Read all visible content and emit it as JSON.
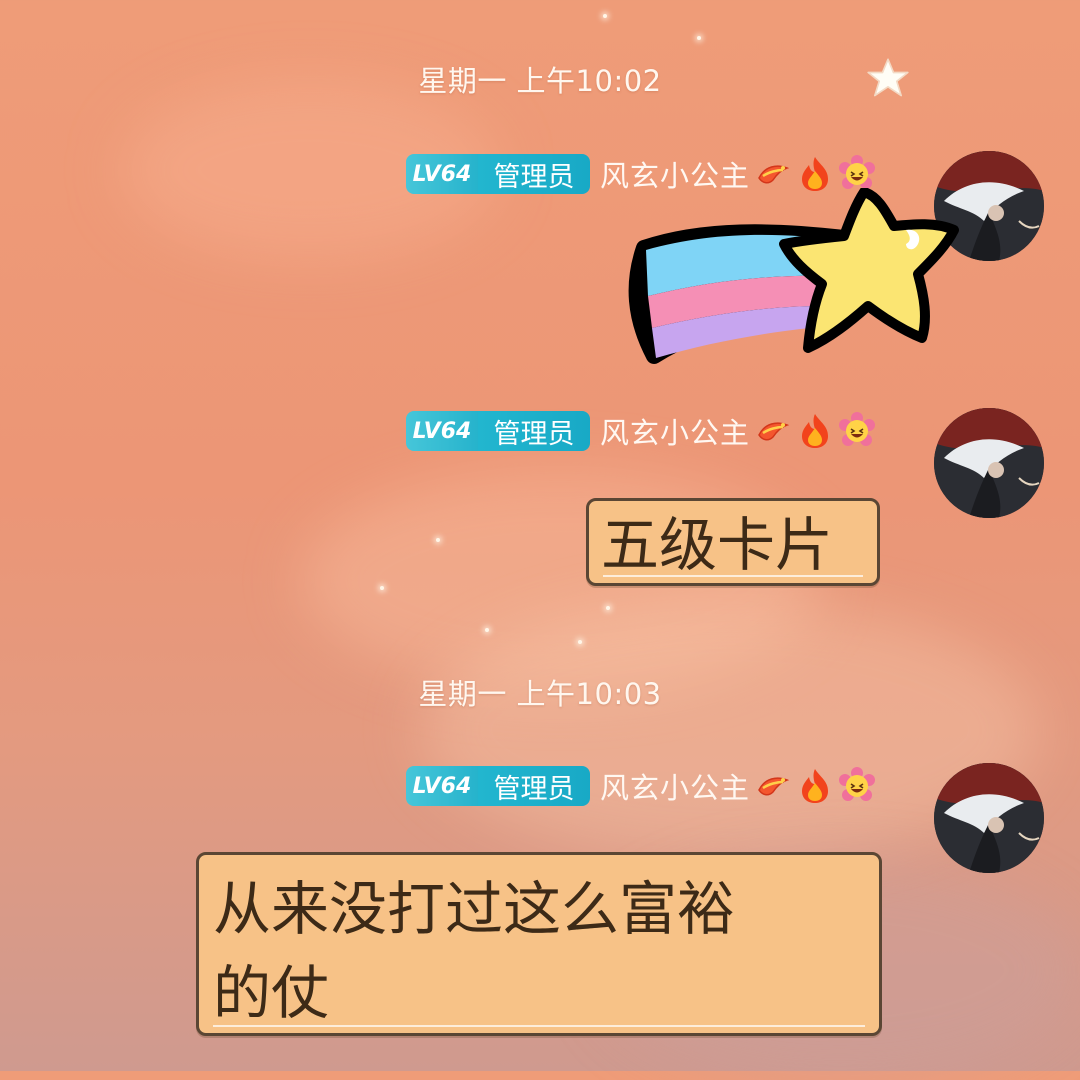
{
  "messages": [
    {
      "timestamp": "星期一 上午10:02",
      "sender": {
        "level": "LV64",
        "role": "管理员",
        "nickname": "风玄小公主"
      },
      "content_type": "sticker",
      "sticker": "rainbow-shooting-star"
    },
    {
      "sender": {
        "level": "LV64",
        "role": "管理员",
        "nickname": "风玄小公主"
      },
      "content_type": "text",
      "text": "五级卡片"
    },
    {
      "timestamp": "星期一 上午10:03",
      "sender": {
        "level": "LV64",
        "role": "管理员",
        "nickname": "风玄小公主"
      },
      "content_type": "text",
      "text": "从来没打过这么富裕\n的仗"
    }
  ],
  "icons": {
    "corner": "star-icon",
    "title_badges": [
      "dragon-emoji",
      "fire-emoji",
      "laughing-flower-emoji"
    ]
  },
  "colors": {
    "background": "#ef9c78",
    "level_badge": "#26b3cc",
    "bubble": "#f7c287",
    "bubble_border": "#5a4634"
  }
}
